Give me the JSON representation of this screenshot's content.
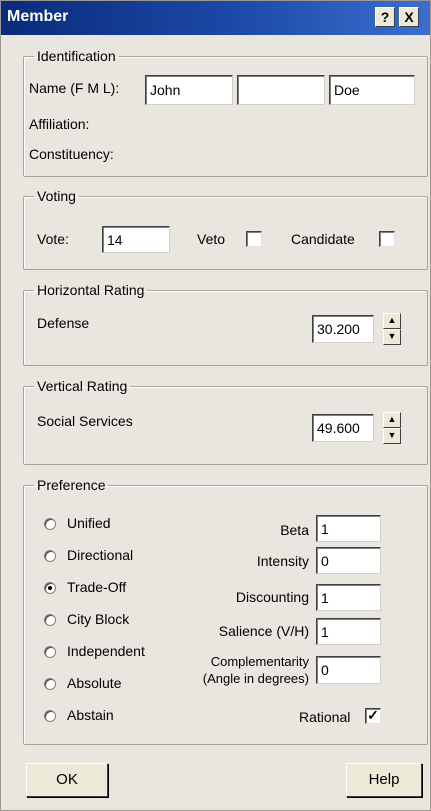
{
  "window": {
    "title": "Member",
    "help_button": "?",
    "close_button": "X"
  },
  "identification": {
    "legend": "Identification",
    "name_label": "Name (F M L):",
    "first": "John",
    "middle": "",
    "last": "Doe",
    "affiliation_label": "Affiliation:",
    "constituency_label": "Constituency:"
  },
  "voting": {
    "legend": "Voting",
    "vote_label": "Vote:",
    "vote_value": "14",
    "veto_label": "Veto",
    "veto_checked": false,
    "candidate_label": "Candidate",
    "candidate_checked": false
  },
  "horizontal": {
    "legend": "Horizontal Rating",
    "label": "Defense",
    "value": "30.200"
  },
  "vertical": {
    "legend": "Vertical Rating",
    "label": "Social Services",
    "value": "49.600"
  },
  "preference": {
    "legend": "Preference",
    "options": [
      "Unified",
      "Directional",
      "Trade-Off",
      "City Block",
      "Independent",
      "Absolute",
      "Abstain"
    ],
    "selected": "Trade-Off",
    "beta_label": "Beta",
    "beta_value": "1",
    "intensity_label": "Intensity",
    "intensity_value": "0",
    "discounting_label": "Discounting",
    "discounting_value": "1",
    "salience_label": "Salience (V/H)",
    "salience_value": "1",
    "complementarity_label_1": "Complementarity",
    "complementarity_label_2": "(Angle in degrees)",
    "complementarity_value": "0",
    "rational_label": "Rational",
    "rational_checked": true
  },
  "buttons": {
    "ok": "OK",
    "help": "Help"
  }
}
